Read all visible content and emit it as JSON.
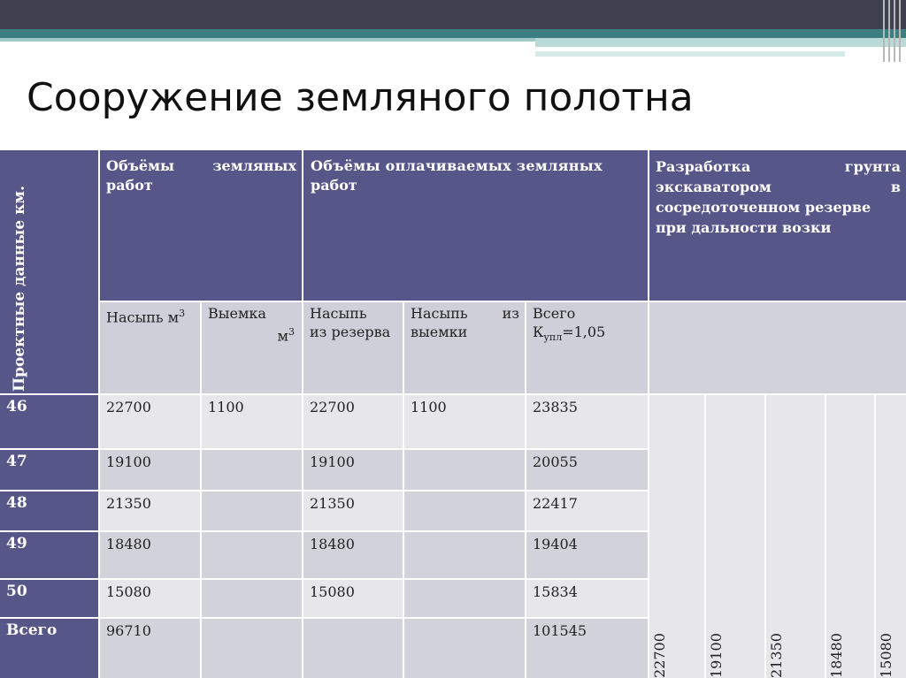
{
  "slide": {
    "title": "Сооружение земляного полотна"
  },
  "table": {
    "row_header_label": "Проектные данные км.",
    "headers": {
      "group1": "Объёмы земляных работ",
      "group1_w1": "Объёмы",
      "group1_w2": "земляных",
      "group1_w3": "работ",
      "group2_l1": "Объёмы оплачиваемых земляных",
      "group2_l2": "работ",
      "group3_l1a": "Разработка",
      "group3_l1b": "грунта",
      "group3_l2a": "экскаватором",
      "group3_l2b": "в",
      "group3_l3": "сосредоточенном резерве",
      "group3_l4": "при дальности возки"
    },
    "subheaders": {
      "fill_m3_a": "Насыпь м",
      "fill_m3_sup": "3",
      "cut_m3_a": "Выемка",
      "cut_m3_b": "м",
      "cut_m3_sup": "3",
      "fill_reserve_a": "Насыпь",
      "fill_reserve_b": "из резерва",
      "fill_cut_a": "Насыпь",
      "fill_cut_b": "из",
      "fill_cut_c": "выемки",
      "total_a": "Всего",
      "total_b": "К",
      "total_sub": "упл",
      "total_c": "=1,05"
    },
    "rows": [
      {
        "label": "46",
        "fill": "22700",
        "cut": "1100",
        "fill_reserve": "22700",
        "fill_cut": "1100",
        "total": "23835"
      },
      {
        "label": "47",
        "fill": "19100",
        "cut": "",
        "fill_reserve": "19100",
        "fill_cut": "",
        "total": "20055"
      },
      {
        "label": "48",
        "fill": "21350",
        "cut": "",
        "fill_reserve": "21350",
        "fill_cut": "",
        "total": "22417"
      },
      {
        "label": "49",
        "fill": "18480",
        "cut": "",
        "fill_reserve": "18480",
        "fill_cut": "",
        "total": "19404"
      },
      {
        "label": "50",
        "fill": "15080",
        "cut": "",
        "fill_reserve": "15080",
        "fill_cut": "",
        "total": "15834"
      },
      {
        "label": "Всего",
        "fill": "96710",
        "cut": "",
        "fill_reserve": "",
        "fill_cut": "",
        "total": "101545"
      }
    ],
    "excavation_values": [
      "22700",
      "19100",
      "21350",
      "18480",
      "15080"
    ]
  }
}
